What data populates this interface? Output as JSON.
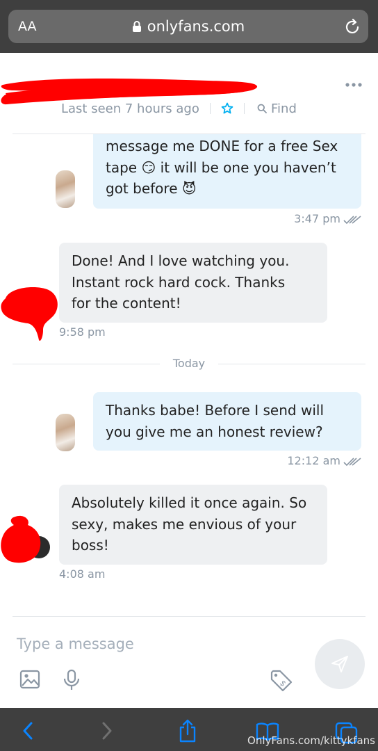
{
  "browser": {
    "text_size_label": "AA",
    "url": "onlyfans.com"
  },
  "header": {
    "last_seen": "Last seen 7 hours ago",
    "find_label": "Find"
  },
  "messages": [
    {
      "direction": "outgoing",
      "lines": [
        "message me DONE for a free Sex",
        "tape 😏 it will be one you haven’t",
        "got before 😈"
      ],
      "time": "3:47 pm",
      "read": true
    },
    {
      "direction": "incoming",
      "lines": [
        "Done! And I love watching you.",
        "Instant rock hard cock. Thanks",
        "for the content!"
      ],
      "time": "9:58 pm"
    },
    {
      "direction": "outgoing",
      "lines": [
        "Thanks babe! Before I send will",
        "you give me an honest review?"
      ],
      "time": "12:12 am",
      "read": true
    },
    {
      "direction": "incoming",
      "lines": [
        "Absolutely killed it once again. So",
        "sexy, makes me envious of your",
        "boss!"
      ],
      "time": "4:08 am"
    }
  ],
  "day_divider": "Today",
  "composer": {
    "placeholder": "Type a message"
  },
  "watermark": "OnlyFans.com/kittykfans",
  "colors": {
    "accent": "#00aff0",
    "meta_text": "#8a96a3",
    "outgoing_bubble": "#e5f3fc",
    "incoming_bubble": "#eef0f2",
    "redaction": "#ff0000",
    "browser_chrome": "#3f3f3f",
    "browser_icon": "#0a84ff"
  },
  "icons": {
    "more": "more-dots-icon",
    "star": "star-icon",
    "find": "search-icon",
    "gallery": "image-icon",
    "voice": "microphone-icon",
    "price": "price-tag-icon",
    "send": "send-icon"
  }
}
